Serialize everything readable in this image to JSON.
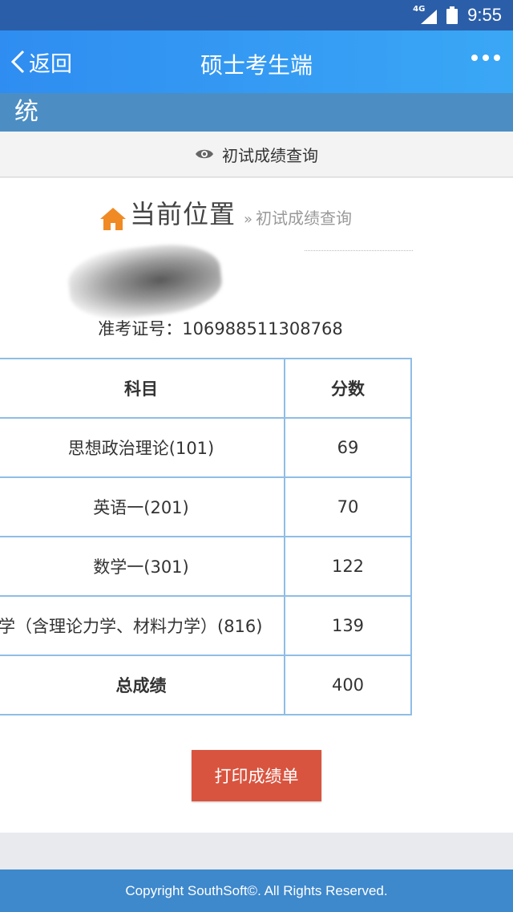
{
  "status_bar": {
    "network": "4G",
    "time": "9:55"
  },
  "app_bar": {
    "back_label": "返回",
    "title": "硕士考生端"
  },
  "strip": {
    "text": "统"
  },
  "tab": {
    "label": "初试成绩查询"
  },
  "breadcrumb": {
    "current": "当前位置",
    "separator": "»",
    "page": "初试成绩查询"
  },
  "exam_id": {
    "label": "准考证号：",
    "value": "106988511308768"
  },
  "score_table": {
    "headers": [
      "科目",
      "分数"
    ],
    "rows": [
      {
        "subject": "思想政治理论(101)",
        "score": "69"
      },
      {
        "subject": "英语一(201)",
        "score": "70"
      },
      {
        "subject": "数学一(301)",
        "score": "122"
      },
      {
        "subject": "学（含理论力学、材料力学）(816)",
        "score": "139"
      }
    ],
    "total": {
      "label": "总成绩",
      "score": "400"
    }
  },
  "print_button": {
    "label": "打印成绩单"
  },
  "footer": {
    "copyright": "Copyright SouthSoft©. All Rights Reserved."
  },
  "colors": {
    "status_bar": "#2b5ea8",
    "header": "#3aa7f5",
    "table_border": "#8fbde6",
    "print_button": "#d9543f",
    "home_icon": "#f08a24",
    "footer": "#3e88cc"
  }
}
